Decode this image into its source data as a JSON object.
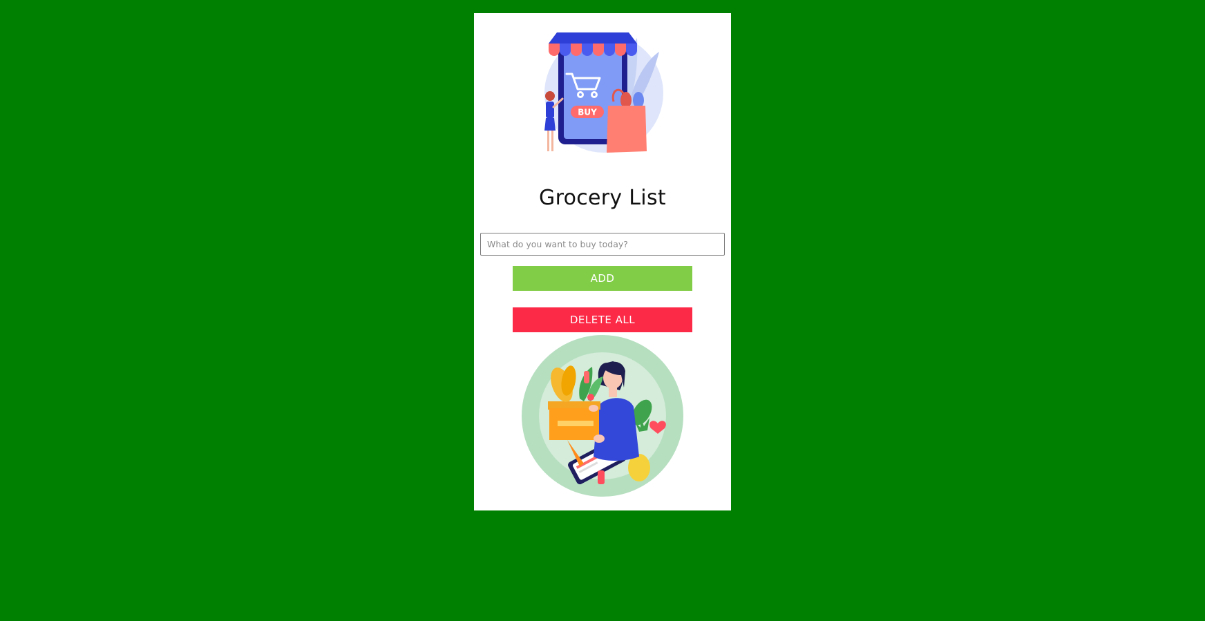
{
  "app": {
    "title": "Grocery List"
  },
  "hero_image": {
    "badge_text": "BUY"
  },
  "form": {
    "input_placeholder": "What do you want to buy today?",
    "input_value": "",
    "add_label": "ADD",
    "delete_all_label": "DELETE ALL"
  },
  "colors": {
    "page_background": "#008000",
    "card_background": "#ffffff",
    "add_button": "#82cd47",
    "delete_button": "#fc2947"
  },
  "icons": [
    "shopping-cart-icon",
    "shopping-bag-icon"
  ]
}
